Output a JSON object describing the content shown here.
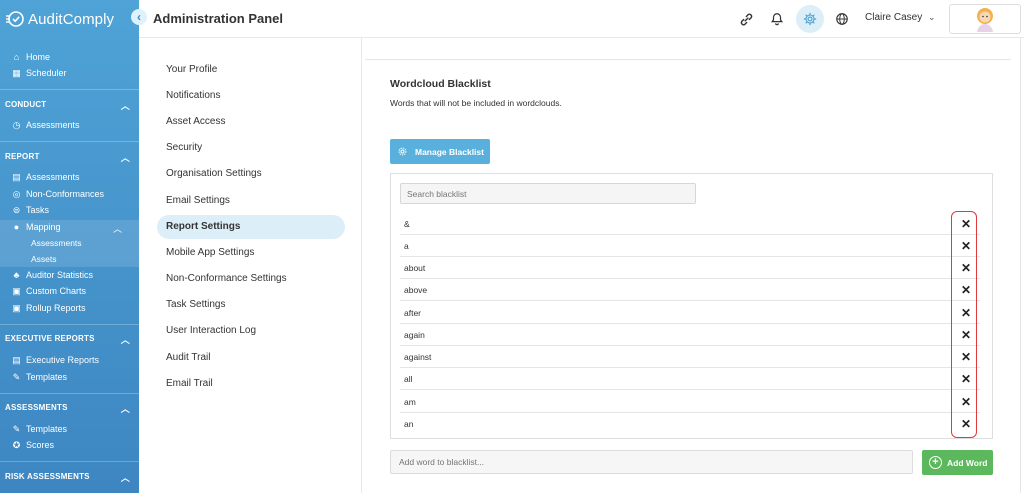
{
  "app": {
    "brand": "AuditComply",
    "collapse_glyph": "‹"
  },
  "header": {
    "title": "Administration Panel",
    "user_name": "Claire Casey",
    "user_chevron": "⌄"
  },
  "sidebar": {
    "top_items": [
      {
        "label": "Home",
        "icon": "home-icon"
      },
      {
        "label": "Scheduler",
        "icon": "calendar-icon"
      }
    ],
    "sections": {
      "conduct": {
        "label": "CONDUCT",
        "items": [
          "Assessments"
        ]
      },
      "report": {
        "label": "REPORT",
        "items": [
          "Assessments",
          "Non-Conformances",
          "Tasks",
          "Mapping",
          "Auditor Statistics",
          "Custom Charts",
          "Rollup Reports"
        ],
        "mapping_sub": [
          "Assessments",
          "Assets"
        ]
      },
      "executive_reports": {
        "label": "EXECUTIVE REPORTS",
        "items": [
          "Executive Reports",
          "Templates"
        ]
      },
      "assessments": {
        "label": "ASSESSMENTS",
        "items": [
          "Templates",
          "Scores"
        ]
      },
      "risk_assessments": {
        "label": "RISK ASSESSMENTS"
      }
    }
  },
  "settings_menu": [
    "Your Profile",
    "Notifications",
    "Asset Access",
    "Security",
    "Organisation Settings",
    "Email Settings",
    "Report Settings",
    "Mobile App Settings",
    "Non-Conformance Settings",
    "Task Settings",
    "User Interaction Log",
    "Audit Trail",
    "Email Trail"
  ],
  "content": {
    "title": "Wordcloud Blacklist",
    "description": "Words that will not be included in wordclouds.",
    "manage_button": "Manage Blacklist",
    "search_placeholder": "Search blacklist",
    "words": [
      "&",
      "a",
      "about",
      "above",
      "after",
      "again",
      "against",
      "all",
      "am",
      "an"
    ],
    "remove_glyph": "✕",
    "add_placeholder": "Add word to blacklist...",
    "add_button": "Add Word"
  },
  "colors": {
    "sidebar_top": "#4fa3d6",
    "sidebar_bottom": "#3d86c2",
    "accent": "#5ab0dc",
    "success": "#5cb85c",
    "highlight": "#e0393e"
  }
}
